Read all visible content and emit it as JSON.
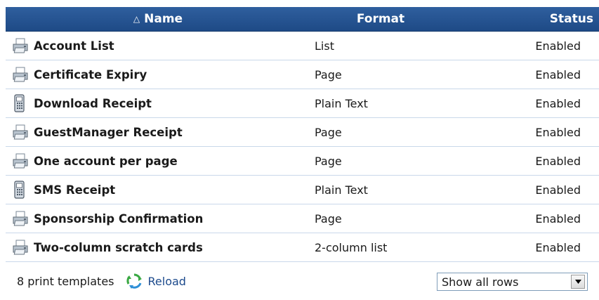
{
  "header": {
    "sort_glyph": "△",
    "name_label": "Name",
    "format_label": "Format",
    "status_label": "Status"
  },
  "rows": [
    {
      "icon": "printer-icon",
      "name": "Account List",
      "format": "List",
      "status": "Enabled"
    },
    {
      "icon": "printer-icon",
      "name": "Certificate Expiry",
      "format": "Page",
      "status": "Enabled"
    },
    {
      "icon": "phone-icon",
      "name": "Download Receipt",
      "format": "Plain Text",
      "status": "Enabled"
    },
    {
      "icon": "printer-icon",
      "name": "GuestManager Receipt",
      "format": "Page",
      "status": "Enabled"
    },
    {
      "icon": "printer-icon",
      "name": "One account per page",
      "format": "Page",
      "status": "Enabled"
    },
    {
      "icon": "phone-icon",
      "name": "SMS Receipt",
      "format": "Plain Text",
      "status": "Enabled"
    },
    {
      "icon": "printer-icon",
      "name": "Sponsorship Confirmation",
      "format": "Page",
      "status": "Enabled"
    },
    {
      "icon": "printer-icon",
      "name": "Two-column scratch cards",
      "format": "2-column list",
      "status": "Enabled"
    }
  ],
  "footer": {
    "count_text": "8 print templates",
    "reload_label": "Reload",
    "rows_select_value": "Show all rows"
  },
  "colors": {
    "header_bg": "#2a5899",
    "row_border": "#c9d8ea",
    "link": "#1c4a8c",
    "reload_green": "#3aa843"
  }
}
